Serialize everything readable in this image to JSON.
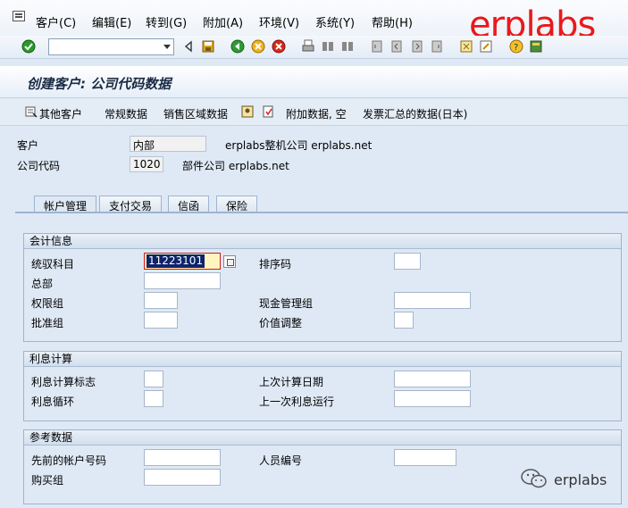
{
  "menu": {
    "items": [
      "客户(C)",
      "编辑(E)",
      "转到(G)",
      "附加(A)",
      "环境(V)",
      "系统(Y)",
      "帮助(H)"
    ]
  },
  "brand": "erplabs",
  "toolbar": {
    "command_value": "",
    "icons": [
      "enter-icon",
      "save-icon",
      "back-icon",
      "exit-icon",
      "cancel-icon",
      "print-icon",
      "find-icon",
      "find-next-icon",
      "first-page-icon",
      "previous-page-icon",
      "next-page-icon",
      "last-page-icon",
      "create-session-icon",
      "shortcut-icon",
      "help-icon",
      "layout-icon"
    ]
  },
  "title": "创建客户: 公司代码数据",
  "app_toolbar": {
    "other_customer": "其他客户",
    "general_data": "常规数据",
    "sales_area_data": "销售区域数据",
    "additional_data": "附加数据, 空",
    "invoice_summary": "发票汇总的数据(日本)"
  },
  "header": {
    "customer_label": "客户",
    "customer_value": "内部",
    "customer_desc": "erplabs整机公司 erplabs.net",
    "company_code_label": "公司代码",
    "company_code_value": "1020",
    "company_code_desc": "部件公司 erplabs.net"
  },
  "tabs": [
    "帐户管理",
    "支付交易",
    "信函",
    "保险"
  ],
  "active_tab": "帐户管理",
  "accounting": {
    "title": "会计信息",
    "recon_account_label": "统驭科目",
    "recon_account_value": "11223101",
    "head_office_label": "总部",
    "authorization_label": "权限组",
    "release_group_label": "批准组",
    "sort_key_label": "排序码",
    "cash_mgmt_label": "现金管理组",
    "value_adjust_label": "价值调整"
  },
  "interest": {
    "title": "利息计算",
    "indicator_label": "利息计算标志",
    "cycle_label": "利息循环",
    "last_date_label": "上次计算日期",
    "last_run_label": "上一次利息运行"
  },
  "reference": {
    "title": "参考数据",
    "prev_account_label": "先前的帐户号码",
    "buying_group_label": "购买组",
    "personnel_label": "人员编号"
  },
  "watermark": "erplabs"
}
